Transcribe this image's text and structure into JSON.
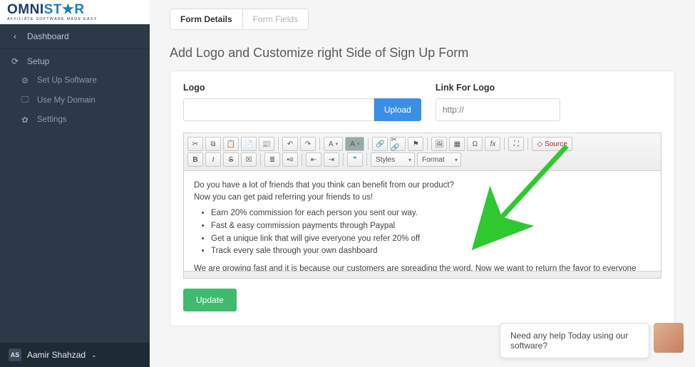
{
  "brand": {
    "word1": "OMNI",
    "word2": "ST★R",
    "sub": "AFFILIATE SOFTWARE MADE EASY"
  },
  "sidebar": {
    "dashboard": "Dashboard",
    "setup": "Setup",
    "items": [
      {
        "label": "Set Up Software"
      },
      {
        "label": "Use My Domain"
      },
      {
        "label": "Settings"
      }
    ]
  },
  "user": {
    "initials": "AS",
    "name": "Aamir Shahzad"
  },
  "tabs": [
    {
      "label": "Form Details",
      "active": true
    },
    {
      "label": "Form Fields",
      "active": false
    }
  ],
  "page": {
    "title": "Add Logo and Customize right Side of Sign Up Form"
  },
  "form": {
    "logo_label": "Logo",
    "upload_label": "Upload",
    "link_label": "Link For Logo",
    "link_value": "http://",
    "update_label": "Update"
  },
  "editor": {
    "styles_label": "Styles",
    "format_label": "Format",
    "source_label": "Source",
    "content": {
      "p1": "Do you have a lot of friends that you think can benefit from our product?",
      "p2": "Now you can get paid referring your friends to us!",
      "bullets": [
        "Earn 20% commission for each person you sent our way.",
        "Fast & easy commission payments through Paypal",
        "Get a unique link that will give everyone you refer 20% off",
        "Track every sale through your own dashboard"
      ],
      "p3": "We are growing fast and it is because our customers are spreading the word. Now we want to return the favor to everyone that has helped us. Start getting paid today!"
    }
  },
  "chat": {
    "message": "Need any help Today using our software?"
  }
}
